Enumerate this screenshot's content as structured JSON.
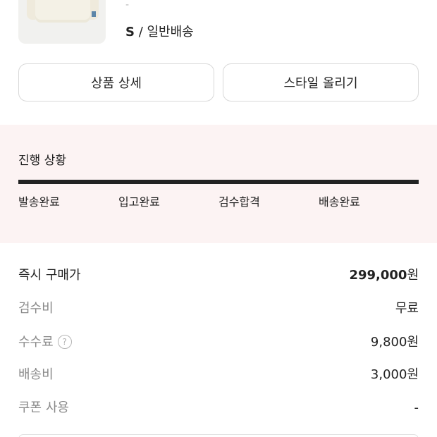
{
  "product": {
    "option_dash": "-",
    "size": "S",
    "separator": " / ",
    "delivery": "일반배송"
  },
  "actions": {
    "detail_label": "상품 상세",
    "style_label": "스타일 올리기"
  },
  "progress": {
    "title": "진행 상황",
    "steps": [
      "발송완료",
      "입고완료",
      "검수합격",
      "배송완료"
    ],
    "completed_fraction": 1.0
  },
  "price": {
    "instant_label": "즉시 구매가",
    "instant_value": "299,000",
    "instant_unit": "원",
    "inspection_label": "검수비",
    "inspection_value": "무료",
    "fee_label": "수수료",
    "fee_help_icon": "?",
    "fee_value": "9,800원",
    "shipping_label": "배송비",
    "shipping_value": "3,000원",
    "coupon_label": "쿠폰 사용",
    "coupon_value": "-"
  }
}
